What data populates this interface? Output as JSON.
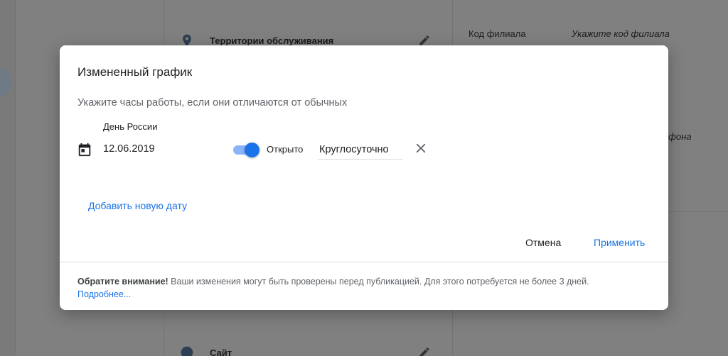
{
  "background": {
    "rows": [
      {
        "label": "Территории обслуживания",
        "icon": "location-pin-icon"
      },
      {
        "label": "Сайт",
        "icon": "globe-icon"
      }
    ],
    "branch_code_label": "Код филиала",
    "branch_code_value": "Укажите код филиала",
    "phone_fragment": "фона"
  },
  "dialog": {
    "title": "Измененный график",
    "subtitle": "Укажите часы работы, если они отличаются от обычных",
    "entry": {
      "date_name": "День России",
      "date_value": "12.06.2019",
      "open_label": "Открыто",
      "open": true,
      "hours_value": "Круглосуточно"
    },
    "add_date_label": "Добавить новую дату",
    "cancel_label": "Отмена",
    "apply_label": "Применить",
    "footer": {
      "bold": "Обратите внимание!",
      "text": " Ваши изменения могут быть проверены перед публикацией. Для этого потребуется не более 3 дней.",
      "link": "Подробнее..."
    }
  },
  "colors": {
    "accent": "#1a73e8",
    "toggle_track": "#8ab4f8",
    "overlay": "#808080"
  }
}
